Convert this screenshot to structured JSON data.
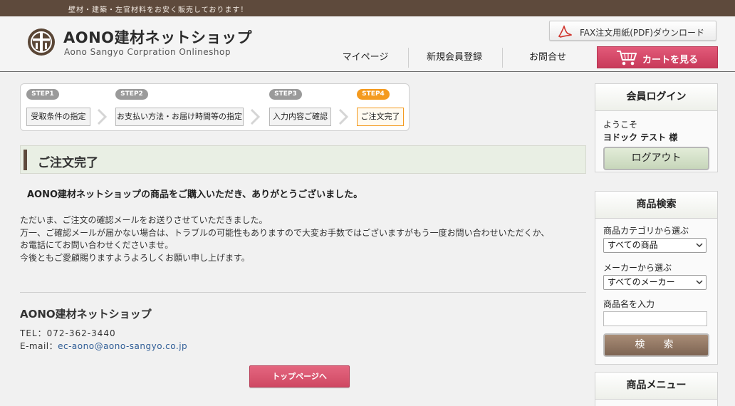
{
  "header": {
    "tagline": "壁材・建築・左官材料をお安く販売しております！",
    "shop_name": "AONO建材ネットショップ",
    "shop_subtitle": "Aono Sangyo  Corpration  Onlineshop",
    "fax_button": "FAX注文用紙(PDF)ダウンロード",
    "nav": [
      "マイページ",
      "新規会員登録",
      "お問合せ"
    ],
    "cart_button": "カートを見る"
  },
  "steps": [
    {
      "badge": "STEP1",
      "label": "受取条件の指定",
      "active": false
    },
    {
      "badge": "STEP2",
      "label": "お支払い方法・お届け時間等の指定",
      "active": false
    },
    {
      "badge": "STEP3",
      "label": "入力内容ご確認",
      "active": false
    },
    {
      "badge": "STEP4",
      "label": "ご注文完了",
      "active": true
    }
  ],
  "main": {
    "title": "ご注文完了",
    "thanks": "AONO建材ネットショップの商品をご購入いただき、ありがとうございました。",
    "lines": [
      "ただいま、ご注文の確認メールをお送りさせていただきました。",
      "万一、ご確認メールが届かない場合は、トラブルの可能性もありますので大変お手数ではございますがもう一度お問い合わせいただくか、",
      "お電話にてお問い合わせくださいませ。",
      "今後ともご愛顧賜りますようよろしくお願い申し上げます。"
    ],
    "footer_shop": "AONO建材ネットショップ",
    "tel": "TEL：072-362-3440",
    "email_label": "E-mail：",
    "email": "ec-aono@aono-sangyo.co.jp",
    "top_button": "トップページへ"
  },
  "sidebar": {
    "login": {
      "title": "会員ログイン",
      "welcome": "ようこそ",
      "user": "ヨドック テスト 様",
      "logout": "ログアウト"
    },
    "search": {
      "title": "商品検索",
      "category_label": "商品カテゴリから選ぶ",
      "category_value": "すべての商品",
      "maker_label": "メーカーから選ぶ",
      "maker_value": "すべてのメーカー",
      "name_label": "商品名を入力",
      "name_value": "",
      "button": "検　索"
    },
    "menu": {
      "title": "商品メニュー"
    }
  },
  "colors": {
    "topbar": "#5e4a3c",
    "accent_pink": "#d1445f",
    "step_active": "#f49a1e",
    "link": "#2f5d96"
  }
}
